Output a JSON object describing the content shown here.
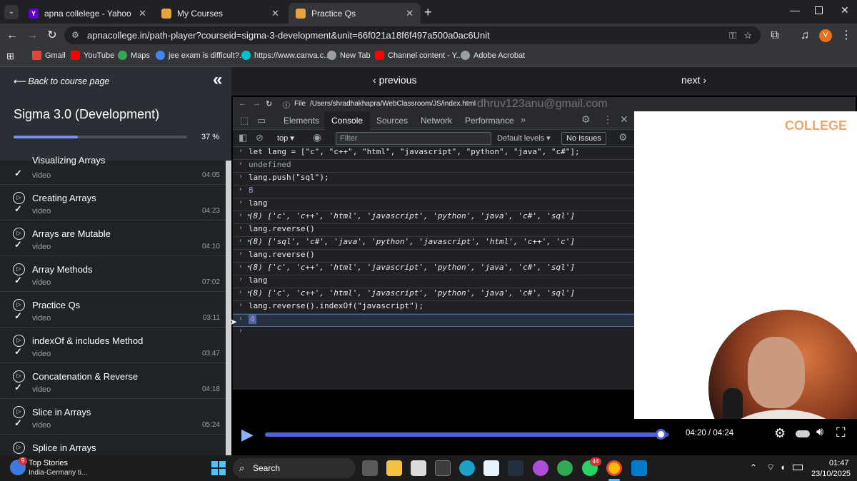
{
  "tabs": [
    {
      "title": "apna collelege - Yahoo Hasil Pe",
      "active": false
    },
    {
      "title": "My Courses",
      "active": false
    },
    {
      "title": "Practice Qs",
      "active": true
    }
  ],
  "address": {
    "url": "apnacollege.in/path-player?courseid=sigma-3-development&unit=66f021a18f6f497a500a0ac6Unit"
  },
  "bookmarks": [
    "Gmail",
    "YouTube",
    "Maps",
    "jee exam is difficult?...",
    "https://www.canva.c...",
    "New Tab",
    "Channel content - Y...",
    "Adobe Acrobat"
  ],
  "sidebar": {
    "back_label": "Back to course page",
    "course_title": "Sigma 3.0 (Development)",
    "progress_text": "37 %",
    "progress_value": 0.37,
    "items": [
      {
        "title": "Visualizing Arrays",
        "type": "video",
        "duration": "04:05"
      },
      {
        "title": "Creating Arrays",
        "type": "video",
        "duration": "04:23"
      },
      {
        "title": "Arrays are Mutable",
        "type": "video",
        "duration": "04:10"
      },
      {
        "title": "Array Methods",
        "type": "video",
        "duration": "07:02"
      },
      {
        "title": "Practice Qs",
        "type": "video",
        "duration": "03:11"
      },
      {
        "title": "indexOf & includes Method",
        "type": "video",
        "duration": "03:47"
      },
      {
        "title": "Concatenation & Reverse",
        "type": "video",
        "duration": "04:18"
      },
      {
        "title": "Slice in Arrays",
        "type": "video",
        "duration": "05:24"
      },
      {
        "title": "Splice in Arrays",
        "type": "video",
        "duration": ""
      }
    ]
  },
  "video_nav": {
    "previous": "previous",
    "next": "next"
  },
  "inner_browser": {
    "file_label": "File",
    "path": "/Users/shradhakhapra/WebClassroom/JS/index.html",
    "watermark": "dhruv123anu@gmail.com",
    "brand": "COLLEGE"
  },
  "devtools": {
    "tabs": [
      "Elements",
      "Console",
      "Sources",
      "Network",
      "Performance"
    ],
    "active_tab": "Console",
    "context": "top",
    "filter_placeholder": "Filter",
    "levels": "Default levels",
    "issues": "No Issues",
    "console": [
      "let lang = [\"c\", \"c++\", \"html\", \"javascript\", \"python\", \"java\", \"c#\"];",
      "undefined",
      "lang.push(\"sql\");",
      "8",
      "lang",
      "(8) ['c', 'c++', 'html', 'javascript', 'python', 'java', 'c#', 'sql']",
      "lang.reverse()",
      "(8) ['sql', 'c#', 'java', 'python', 'javascript', 'html', 'c++', 'c']",
      "lang.reverse()",
      "(8) ['c', 'c++', 'html', 'javascript', 'python', 'java', 'c#', 'sql']",
      "lang",
      "(8) ['c', 'c++', 'html', 'javascript', 'python', 'java', 'c#', 'sql']",
      "lang.reverse().indexOf(\"javascript\");",
      "4"
    ]
  },
  "player": {
    "time": "04:20 / 04:24",
    "progress": 0.98
  },
  "taskbar": {
    "news_title": "Top Stories",
    "news_sub": "India-Germany ti...",
    "news_badge": "9",
    "search": "Search",
    "whatsapp_badge": "44",
    "time": "01:47",
    "date": "23/10/2025"
  }
}
